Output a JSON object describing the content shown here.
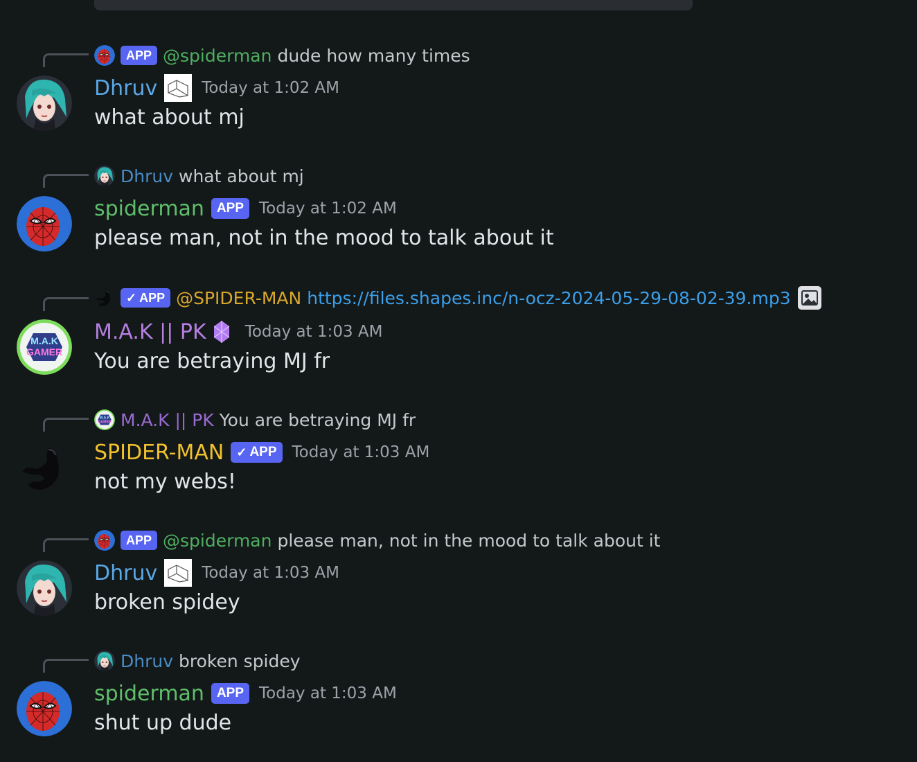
{
  "app_badge_label": "APP",
  "messages": [
    {
      "reply": {
        "name": "@spiderman",
        "text": "dude how many times"
      },
      "author": "Dhruv",
      "timestamp": "Today at 1:02 AM",
      "content": "what about mj"
    },
    {
      "reply": {
        "name": "Dhruv",
        "text": "what about mj"
      },
      "author": "spiderman",
      "timestamp": "Today at 1:02 AM",
      "content": "please man, not in the mood to talk about it"
    },
    {
      "reply": {
        "name": "@SPIDER-MAN",
        "text": "https://files.shapes.inc/n-ocz-2024-05-29-08-02-39.mp3"
      },
      "author": "M.A.K || PK",
      "timestamp": "Today at 1:03 AM",
      "content": "You are betraying MJ fr"
    },
    {
      "reply": {
        "name": "M.A.K || PK",
        "text": "You are betraying MJ fr"
      },
      "author": "SPIDER-MAN",
      "timestamp": "Today at 1:03 AM",
      "content": "not my webs!"
    },
    {
      "reply": {
        "name": "@spiderman",
        "text": "please man, not in the mood to talk about it"
      },
      "author": "Dhruv",
      "timestamp": "Today at 1:03 AM",
      "content": "broken spidey"
    },
    {
      "reply": {
        "name": "Dhruv",
        "text": "broken spidey"
      },
      "author": "spiderman",
      "timestamp": "Today at 1:03 AM",
      "content": "shut up dude"
    }
  ],
  "colors": {
    "background": "#131819",
    "dhruv": "#5ba8e6",
    "spiderman": "#5fbf6a",
    "mak": "#b57fe0",
    "spider_man_caps": "#f2c12e",
    "app_badge": "#5865f2",
    "link": "#3c9fe8"
  },
  "icons": {
    "verified": "checkmark-icon",
    "image_attachment": "image-icon",
    "nitro_gem": "gem-icon"
  }
}
